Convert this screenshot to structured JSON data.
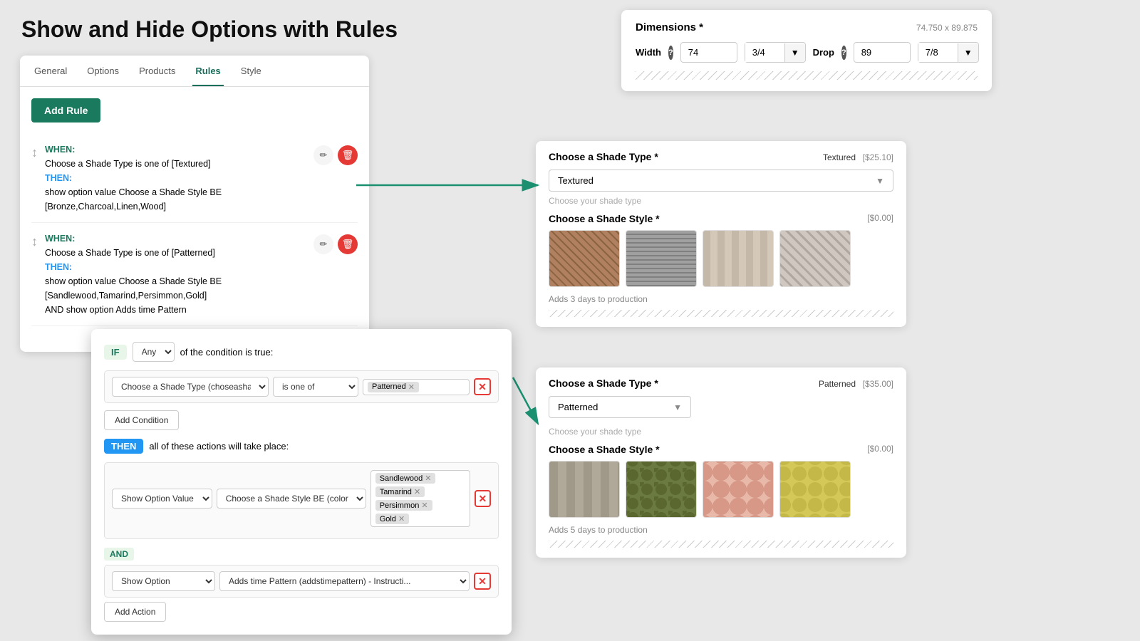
{
  "title": "Show and Hide Options with Rules",
  "tabs": [
    "General",
    "Options",
    "Products",
    "Rules",
    "Style"
  ],
  "active_tab": "Rules",
  "add_rule_label": "Add Rule",
  "rules": [
    {
      "when_label": "WHEN:",
      "when_text": "Choose a Shade Type is one of [Textured]",
      "then_label": "THEN:",
      "then_text": "show option value Choose a Shade Style BE [Bronze,Charcoal,Linen,Wood]"
    },
    {
      "when_label": "WHEN:",
      "when_text": "Choose a Shade Type is one of [Patterned]",
      "then_label": "THEN:",
      "then_text": "show option value Choose a Shade Style BE [Sandlewood,Tamarind,Persimmon,Gold]",
      "and_text": "AND show option Adds time Pattern"
    }
  ],
  "dialog": {
    "if_label": "IF",
    "any_label": "Any",
    "condition_text": "of the condition is true:",
    "condition": {
      "field": "Choose a Shade Type (choseashadestyletype) - ...",
      "operator": "is one of",
      "value": "Patterned"
    },
    "add_condition_label": "Add Condition",
    "then_label": "THEN",
    "then_text": "all of these actions will take place:",
    "action1": {
      "type": "Show Option Value",
      "field": "Choose a Shade Style BE (color) - Swatch",
      "values": [
        "Sandlewood",
        "Tamarind",
        "Persimmon",
        "Gold"
      ]
    },
    "action2": {
      "type": "Show Option",
      "field": "Adds time Pattern (addstimepattern) - Instructi..."
    },
    "add_action_label": "Add Action"
  },
  "dimensions": {
    "title": "Dimensions *",
    "value": "74.750 x 89.875",
    "width_label": "Width",
    "drop_label": "Drop",
    "width_value": "74",
    "width_fraction": "3/4",
    "drop_value": "89",
    "drop_fraction": "7/8"
  },
  "shade_section_1": {
    "title": "Choose a Shade Type *",
    "value_label": "Textured",
    "price": "[$25.10]",
    "selected": "Textured",
    "placeholder": "Choose your shade type",
    "style_title": "Choose a Shade Style *",
    "style_price": "[$0.00]",
    "adds_days": "Adds 3 days to production",
    "swatches": [
      "Bronze",
      "Charcoal",
      "Linen",
      "Wood"
    ]
  },
  "shade_section_2": {
    "title": "Choose a Shade Type *",
    "value_label": "Patterned",
    "price": "[$35.00]",
    "selected": "Patterned",
    "placeholder": "Choose your shade type",
    "style_title": "Choose a Shade Style *",
    "style_price": "[$0.00]",
    "adds_days": "Adds 5 days to production",
    "swatches": [
      "Sandlewood",
      "Tamarind",
      "Persimmon",
      "Gold"
    ]
  }
}
